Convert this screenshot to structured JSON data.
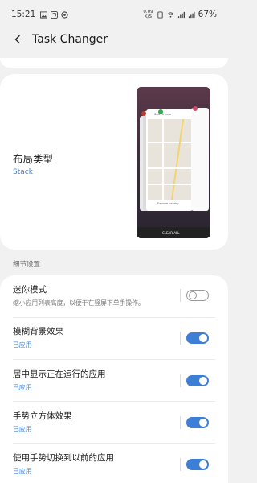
{
  "status_bar": {
    "time": "15:21",
    "net_speed_value": "0.09",
    "net_speed_unit": "K/S",
    "battery": "67%"
  },
  "app_bar": {
    "title": "Task Changer"
  },
  "layout": {
    "title": "布局类型",
    "value": "Stack",
    "preview": {
      "search_placeholder": "Search here",
      "explore_label": "Explore nearby",
      "clear_label": "CLEAR ALL"
    }
  },
  "details": {
    "header": "细节设置",
    "items": [
      {
        "title": "迷你模式",
        "subtitle": "缩小应用列表高度，以便于在竖屏下单手操作。",
        "enabled": false
      },
      {
        "title": "模糊背景效果",
        "subtitle": "已应用",
        "enabled": true
      },
      {
        "title": "居中显示正在运行的应用",
        "subtitle": "已应用",
        "enabled": true
      },
      {
        "title": "手势立方体效果",
        "subtitle": "已应用",
        "enabled": true
      },
      {
        "title": "使用手势切换到以前的应用",
        "subtitle": "已应用",
        "enabled": true
      }
    ]
  },
  "colors": {
    "accent": "#3d7fd6",
    "background": "#f1f1f1",
    "card": "#ffffff"
  }
}
